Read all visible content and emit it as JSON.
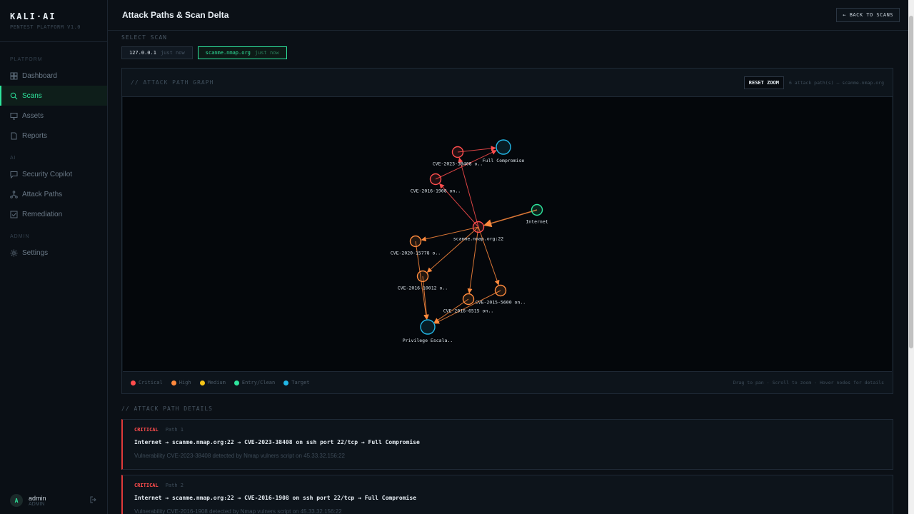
{
  "brand": {
    "title": "KALI·AI",
    "subtitle": "PENTEST PLATFORM V1.0"
  },
  "sidebar": {
    "sections": [
      {
        "label": "PLATFORM",
        "items": [
          {
            "label": "Dashboard",
            "icon": "grid-icon",
            "active": false
          },
          {
            "label": "Scans",
            "icon": "search-icon",
            "active": true
          },
          {
            "label": "Assets",
            "icon": "monitor-icon",
            "active": false
          },
          {
            "label": "Reports",
            "icon": "document-icon",
            "active": false
          }
        ]
      },
      {
        "label": "AI",
        "items": [
          {
            "label": "Security Copilot",
            "icon": "chat-icon",
            "active": false
          },
          {
            "label": "Attack Paths",
            "icon": "network-icon",
            "active": false
          },
          {
            "label": "Remediation",
            "icon": "check-square-icon",
            "active": false
          }
        ]
      },
      {
        "label": "ADMIN",
        "items": [
          {
            "label": "Settings",
            "icon": "gear-icon",
            "active": false
          }
        ]
      }
    ],
    "user": {
      "initial": "A",
      "name": "admin",
      "role": "ADMIN"
    }
  },
  "header": {
    "title": "Attack Paths & Scan Delta",
    "back_label": "← BACK TO SCANS"
  },
  "scan_select": {
    "label": "SELECT SCAN",
    "scans": [
      {
        "name": "127.0.0.1",
        "time": "just now",
        "active": false
      },
      {
        "name": "scanme.nmap.org",
        "time": "just now",
        "active": true
      }
    ]
  },
  "graph": {
    "title": "// ATTACK PATH GRAPH",
    "reset_label": "RESET ZOOM",
    "meta": "6 attack path(s) — scanme.nmap.org",
    "nodes": [
      {
        "id": "internet",
        "label": "Internet",
        "severity": "entry"
      },
      {
        "id": "host",
        "label": "scanme.nmap.org:22",
        "severity": "critical"
      },
      {
        "id": "cve1",
        "label": "CVE-2023-38408 o..",
        "severity": "critical"
      },
      {
        "id": "cve2",
        "label": "CVE-2016-1908 on..",
        "severity": "critical"
      },
      {
        "id": "full",
        "label": "Full Compromise",
        "severity": "target"
      },
      {
        "id": "cve3",
        "label": "CVE-2020-15778 o..",
        "severity": "high"
      },
      {
        "id": "cve4",
        "label": "CVE-2016-10012 o..",
        "severity": "high"
      },
      {
        "id": "cve5",
        "label": "CVE-2016-6515 on..",
        "severity": "high"
      },
      {
        "id": "cve6",
        "label": "CVE-2015-5600 on..",
        "severity": "high"
      },
      {
        "id": "priv",
        "label": "Privilege Escala..",
        "severity": "target"
      }
    ],
    "edges": [
      {
        "from": "internet",
        "to": "host",
        "severity": "high"
      },
      {
        "from": "host",
        "to": "cve1",
        "severity": "critical"
      },
      {
        "from": "host",
        "to": "cve2",
        "severity": "critical"
      },
      {
        "from": "cve1",
        "to": "full",
        "severity": "critical"
      },
      {
        "from": "cve2",
        "to": "full",
        "severity": "critical"
      },
      {
        "from": "host",
        "to": "cve3",
        "severity": "high"
      },
      {
        "from": "host",
        "to": "cve4",
        "severity": "high"
      },
      {
        "from": "host",
        "to": "cve5",
        "severity": "high"
      },
      {
        "from": "host",
        "to": "cve6",
        "severity": "high"
      },
      {
        "from": "cve3",
        "to": "priv",
        "severity": "high"
      },
      {
        "from": "cve4",
        "to": "priv",
        "severity": "high"
      },
      {
        "from": "cve5",
        "to": "priv",
        "severity": "high"
      },
      {
        "from": "cve6",
        "to": "priv",
        "severity": "high"
      }
    ],
    "legend": [
      {
        "label": "Critical",
        "color": "#ff4d4d"
      },
      {
        "label": "High",
        "color": "#ff8a3d"
      },
      {
        "label": "Medium",
        "color": "#f5c518"
      },
      {
        "label": "Entry/Clean",
        "color": "#2ee59d"
      },
      {
        "label": "Target",
        "color": "#22b8e8"
      }
    ],
    "hint": "Drag to pan · Scroll to zoom · Hover nodes for details"
  },
  "colors": {
    "critical": "#ff4d4d",
    "high": "#ff8a3d",
    "entry": "#2ee59d",
    "target": "#22b8e8",
    "accent": "#2ee59d"
  },
  "details": {
    "label": "// ATTACK PATH DETAILS",
    "paths": [
      {
        "severity": "CRITICAL",
        "name": "Path 1",
        "chain": "Internet → scanme.nmap.org:22 → CVE-2023-38408 on ssh port 22/tcp → Full Compromise",
        "desc": "Vulnerability CVE-2023-38408 detected by Nmap vulners script on 45.33.32.156:22"
      },
      {
        "severity": "CRITICAL",
        "name": "Path 2",
        "chain": "Internet → scanme.nmap.org:22 → CVE-2016-1908 on ssh port 22/tcp → Full Compromise",
        "desc": "Vulnerability CVE-2016-1908 detected by Nmap vulners script on 45.33.32.156:22"
      }
    ]
  }
}
